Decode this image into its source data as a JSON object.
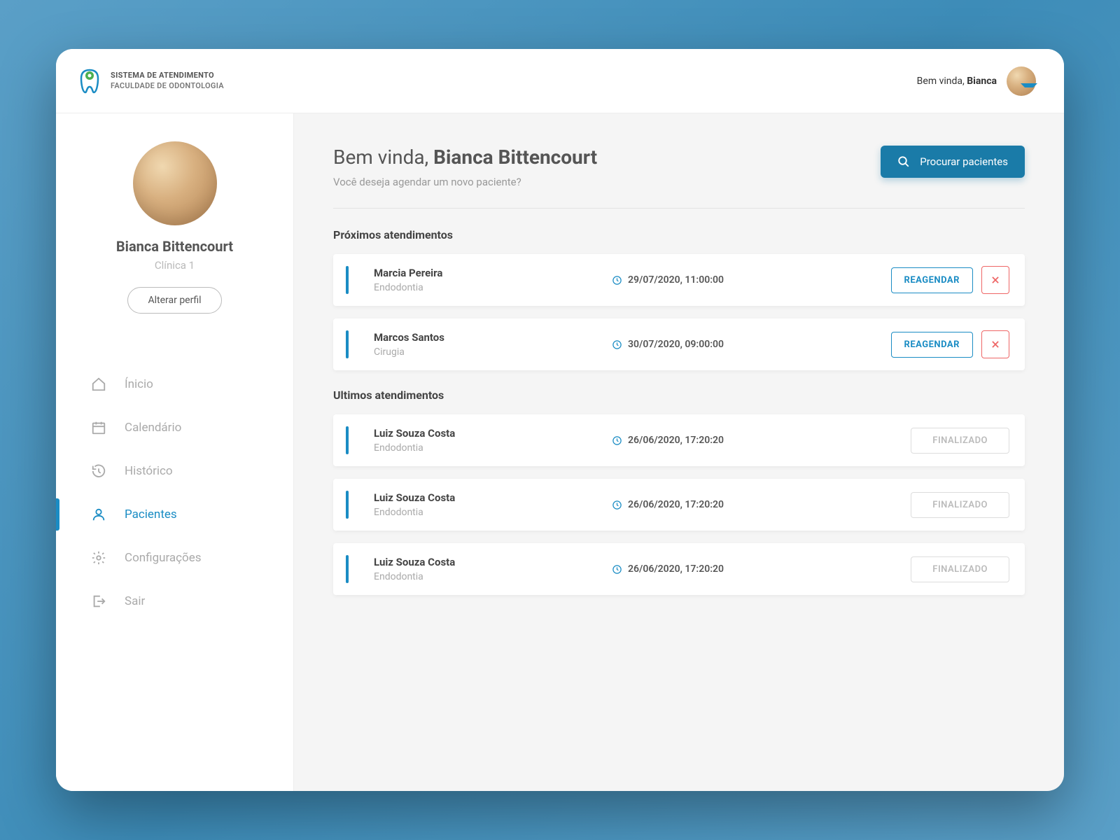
{
  "brand": {
    "line1": "SISTEMA DE ATENDIMENTO",
    "line2": "FACULDADE DE ODONTOLOGIA"
  },
  "topbar": {
    "welcome_prefix": "Bem vinda, ",
    "welcome_name": "Bianca"
  },
  "sidebar": {
    "user_name": "Bianca Bittencourt",
    "clinic": "Clínica 1",
    "edit_profile": "Alterar perfil",
    "nav": [
      {
        "label": "Ínicio",
        "icon": "home"
      },
      {
        "label": "Calendário",
        "icon": "calendar"
      },
      {
        "label": "Histórico",
        "icon": "history"
      },
      {
        "label": "Pacientes",
        "icon": "person"
      },
      {
        "label": "Configurações",
        "icon": "gear"
      },
      {
        "label": "Sair",
        "icon": "logout"
      }
    ]
  },
  "main": {
    "greeting_prefix": "Bem vinda, ",
    "greeting_name": "Bianca Bittencourt",
    "subtitle": "Você deseja agendar um novo paciente?",
    "search_label": "Procurar pacientes",
    "upcoming_title": "Próximos atendimentos",
    "recent_title": "Ultimos atendimentos",
    "reschedule_label": "REAGENDAR",
    "finished_label": "FINALIZADO",
    "upcoming": [
      {
        "name": "Marcia Pereira",
        "spec": "Endodontia",
        "time": "29/07/2020, 11:00:00"
      },
      {
        "name": "Marcos Santos",
        "spec": "Cirugia",
        "time": "30/07/2020, 09:00:00"
      }
    ],
    "recent": [
      {
        "name": "Luiz Souza Costa",
        "spec": "Endodontia",
        "time": "26/06/2020, 17:20:20"
      },
      {
        "name": "Luiz Souza Costa",
        "spec": "Endodontia",
        "time": "26/06/2020, 17:20:20"
      },
      {
        "name": "Luiz Souza Costa",
        "spec": "Endodontia",
        "time": "26/06/2020, 17:20:20"
      }
    ]
  }
}
